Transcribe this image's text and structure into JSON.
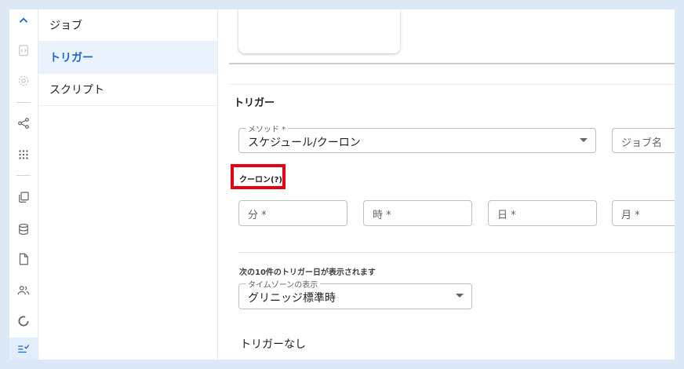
{
  "subnav": {
    "items": [
      {
        "label": "ジョブ",
        "active": false
      },
      {
        "label": "トリガー",
        "active": true
      },
      {
        "label": "スクリプト",
        "active": false
      }
    ]
  },
  "rail_icons": [
    "chevron-up-icon",
    "code-file-icon",
    "gear-icon",
    "share-icon",
    "grid-icon",
    "copy-icon",
    "database-icon",
    "file-icon",
    "users-icon",
    "donut-chart-icon",
    "checklist-icon"
  ],
  "trigger": {
    "section_title": "トリガー",
    "method_label": "メソッド *",
    "method_value": "スケジュール/クーロン",
    "job_name_placeholder": "ジョブ名",
    "cron_label": "クーロン(?)",
    "minute_placeholder": "分 *",
    "hour_placeholder": "時 *",
    "day_placeholder": "日 *",
    "month_placeholder": "月 *",
    "next_triggers_hint": "次の10件のトリガー日が表示されます",
    "timezone_label": "タイムゾーンの表示",
    "timezone_value": "グリニッジ標準時",
    "no_trigger_text": "トリガーなし"
  },
  "colors": {
    "accent": "#1967d2",
    "highlight": "#e60012",
    "page_bg": "#dde8f6"
  }
}
